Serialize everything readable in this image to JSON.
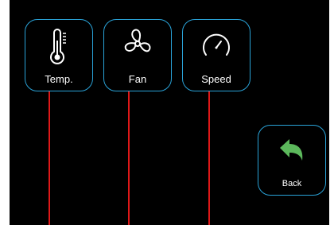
{
  "tiles": {
    "temp": {
      "label": "Temp.",
      "icon": "thermometer-icon"
    },
    "fan": {
      "label": "Fan",
      "icon": "fan-icon"
    },
    "speed": {
      "label": "Speed",
      "icon": "speedometer-icon"
    },
    "back": {
      "label": "Back",
      "icon": "back-arrow-icon"
    }
  },
  "colors": {
    "background": "#000000",
    "tile_border": "#2aa3d8",
    "text": "#ffffff",
    "back_arrow": "#5cb85c",
    "wire": "#e01818"
  }
}
